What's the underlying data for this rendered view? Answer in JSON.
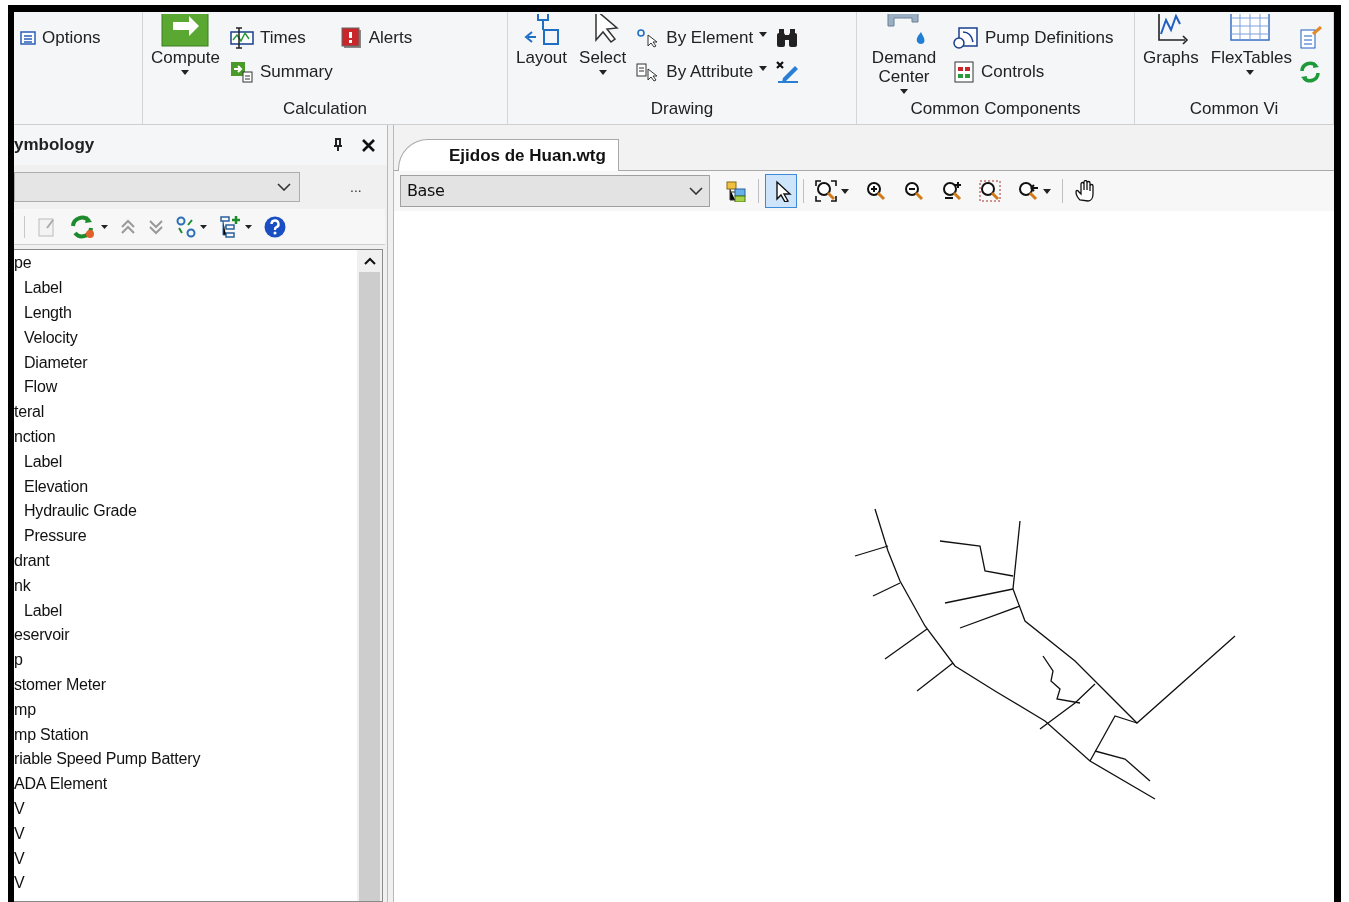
{
  "ribbon": {
    "groups": [
      {
        "columns": [
          [
            {
              "kind": "small",
              "label": "Options",
              "dropdown": false
            }
          ]
        ]
      },
      {
        "label": "Calculation",
        "columns": [
          [
            {
              "kind": "large",
              "label": "Compute",
              "dropdown": true
            }
          ],
          [
            {
              "kind": "small",
              "label": "Times",
              "dropdown": false
            },
            {
              "kind": "small",
              "label": "Summary",
              "dropdown": false
            }
          ],
          [
            {
              "kind": "small",
              "label": "Alerts",
              "dropdown": false
            }
          ]
        ]
      },
      {
        "label": "Drawing",
        "columns": [
          [
            {
              "kind": "large",
              "label": "Layout",
              "dropdown": false
            }
          ],
          [
            {
              "kind": "large",
              "label": "Select",
              "dropdown": true
            }
          ],
          [
            {
              "kind": "small",
              "label": "By Element",
              "dropdown": true
            },
            {
              "kind": "small",
              "label": "By Attribute",
              "dropdown": true
            }
          ],
          [
            {
              "kind": "icon"
            },
            {
              "kind": "icon"
            }
          ]
        ]
      },
      {
        "label": "Common Components",
        "columns": [
          [
            {
              "kind": "large",
              "label": "Demand Center",
              "dropdown": true
            }
          ],
          [
            {
              "kind": "small",
              "label": "Pump Definitions",
              "dropdown": false
            },
            {
              "kind": "small",
              "label": "Controls",
              "dropdown": false
            }
          ]
        ]
      },
      {
        "label": "Common Vi",
        "columns": [
          [
            {
              "kind": "large",
              "label": "Graphs",
              "dropdown": false
            }
          ],
          [
            {
              "kind": "large",
              "label": "FlexTables",
              "dropdown": true
            }
          ],
          [
            {
              "kind": "icon"
            },
            {
              "kind": "icon"
            }
          ]
        ]
      }
    ]
  },
  "panel": {
    "title": "ymbology",
    "more": "...",
    "tree": [
      {
        "label": "pe",
        "children": [
          {
            "label": "Label"
          },
          {
            "label": "Length"
          },
          {
            "label": "Velocity"
          },
          {
            "label": "Diameter"
          },
          {
            "label": "Flow"
          }
        ]
      },
      {
        "label": "teral"
      },
      {
        "label": "nction",
        "children": [
          {
            "label": "Label"
          },
          {
            "label": "Elevation"
          },
          {
            "label": "Hydraulic Grade"
          },
          {
            "label": "Pressure"
          }
        ]
      },
      {
        "label": "drant"
      },
      {
        "label": "nk",
        "children": [
          {
            "label": "Label"
          }
        ]
      },
      {
        "label": "eservoir"
      },
      {
        "label": "p"
      },
      {
        "label": "stomer Meter"
      },
      {
        "label": "mp"
      },
      {
        "label": "mp Station"
      },
      {
        "label": "riable Speed Pump Battery"
      },
      {
        "label": "ADA Element"
      },
      {
        "label": "V"
      },
      {
        "label": "V"
      },
      {
        "label": "V"
      },
      {
        "label": "V"
      }
    ]
  },
  "document": {
    "tab": {
      "label": "Ejidos de Huan.wtg",
      "selected": true
    },
    "scenario": "Base",
    "tools": [
      {
        "selected": false
      },
      {
        "selected": true
      },
      {
        "selected": false
      },
      {
        "selected": false
      },
      {
        "selected": false
      },
      {
        "selected": false
      },
      {
        "selected": false
      },
      {
        "selected": false
      },
      {
        "selected": false
      }
    ]
  }
}
